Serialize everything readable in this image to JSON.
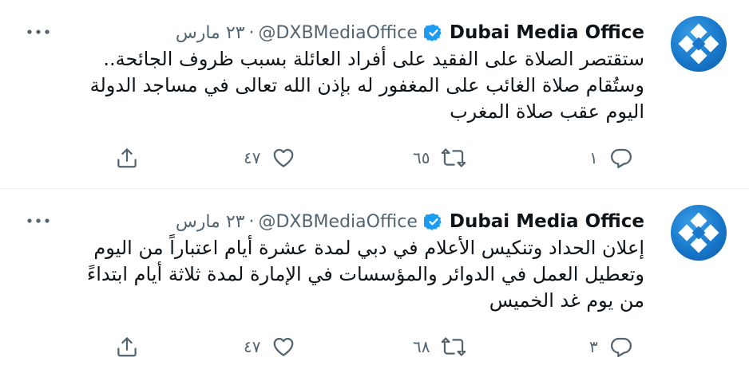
{
  "tweets": [
    {
      "author": "Dubai Media Office",
      "handle": "@DXBMediaOffice",
      "separator": "·",
      "date": "٢٣ مارس",
      "text_lines": [
        "ستقتصر الصلاة على الفقيد على أفراد العائلة بسبب ظروف الجائحة..",
        "وستُقام صلاة الغائب على المغفور له بإذن الله تعالى في مساجد الدولة",
        "اليوم عقب صلاة المغرب"
      ],
      "replies": "١",
      "retweets": "٦٥",
      "likes": "٤٧"
    },
    {
      "author": "Dubai Media Office",
      "handle": "@DXBMediaOffice",
      "separator": "·",
      "date": "٢٣ مارس",
      "text_lines": [
        "إعلان الحداد وتنكيس الأعلام في دبي لمدة عشرة أيام اعتباراً من اليوم",
        "وتعطيل العمل في الدوائر والمؤسسات في الإمارة لمدة ثلاثة أيام ابتداءً",
        "من يوم غد الخميس"
      ],
      "replies": "٣",
      "retweets": "٦٨",
      "likes": "٤٧"
    }
  ],
  "icons": {
    "avatar": "dubai-media-office-logo",
    "verified": "verified-badge-icon",
    "more": "more-dots-icon",
    "reply": "reply-icon",
    "retweet": "retweet-icon",
    "like": "heart-icon",
    "share": "share-icon"
  },
  "colors": {
    "verified": "#1d9bf0",
    "secondary_text": "#536471",
    "primary_text": "#0f1419",
    "avatar_blue": "#1877c9"
  }
}
